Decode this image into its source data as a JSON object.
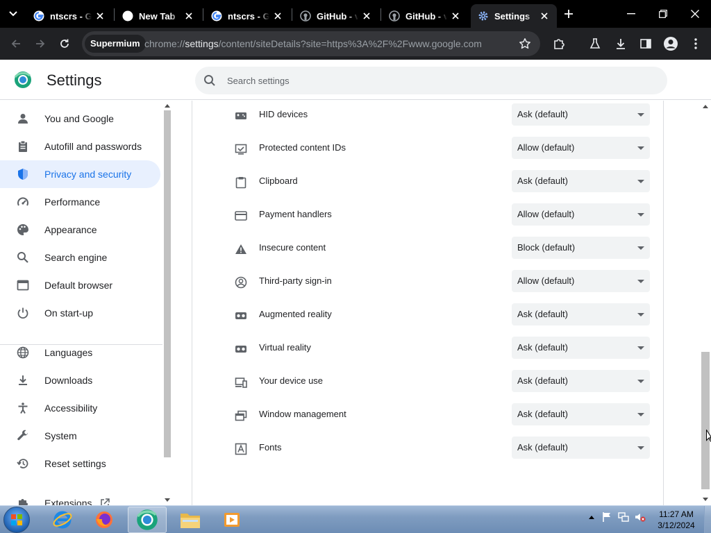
{
  "tabs": [
    {
      "title": "ntscrs - Go",
      "favicon": "google-icon"
    },
    {
      "title": "New Tab",
      "favicon": "newtab-icon"
    },
    {
      "title": "ntscrs - Go",
      "favicon": "google-icon"
    },
    {
      "title": "GitHub - v",
      "favicon": "github-icon"
    },
    {
      "title": "GitHub - v",
      "favicon": "github-icon"
    },
    {
      "title": "Settings",
      "favicon": "gear-icon",
      "active": true
    }
  ],
  "toolbar": {
    "browser_chip": "Supermium",
    "url_prefix": "chrome://",
    "url_host": "settings",
    "url_rest": "/content/siteDetails?site=https%3A%2F%2Fwww.google.com"
  },
  "header": {
    "title": "Settings",
    "search_placeholder": "Search settings"
  },
  "sidebar": {
    "items": [
      {
        "label": "You and Google",
        "icon": "person-icon"
      },
      {
        "label": "Autofill and passwords",
        "icon": "clipboard-icon"
      },
      {
        "label": "Privacy and security",
        "icon": "shield-icon",
        "selected": true
      },
      {
        "label": "Performance",
        "icon": "speedometer-icon"
      },
      {
        "label": "Appearance",
        "icon": "palette-icon"
      },
      {
        "label": "Search engine",
        "icon": "search-icon"
      },
      {
        "label": "Default browser",
        "icon": "browser-icon"
      },
      {
        "label": "On start-up",
        "icon": "power-icon"
      },
      {
        "label": "Languages",
        "icon": "globe-icon"
      },
      {
        "label": "Downloads",
        "icon": "download-icon"
      },
      {
        "label": "Accessibility",
        "icon": "accessibility-icon"
      },
      {
        "label": "System",
        "icon": "wrench-icon"
      },
      {
        "label": "Reset settings",
        "icon": "restore-icon"
      },
      {
        "label": "Extensions",
        "icon": "puzzle-icon"
      }
    ]
  },
  "permissions": [
    {
      "label": "HID devices",
      "value": "Ask (default)",
      "icon": "hid-icon"
    },
    {
      "label": "Protected content IDs",
      "value": "Allow (default)",
      "icon": "protected-content-icon"
    },
    {
      "label": "Clipboard",
      "value": "Ask (default)",
      "icon": "clipboard-icon"
    },
    {
      "label": "Payment handlers",
      "value": "Allow (default)",
      "icon": "credit-card-icon"
    },
    {
      "label": "Insecure content",
      "value": "Block (default)",
      "icon": "warning-icon"
    },
    {
      "label": "Third-party sign-in",
      "value": "Allow (default)",
      "icon": "account-circle-icon"
    },
    {
      "label": "Augmented reality",
      "value": "Ask (default)",
      "icon": "vr-headset-icon"
    },
    {
      "label": "Virtual reality",
      "value": "Ask (default)",
      "icon": "vr-headset-icon"
    },
    {
      "label": "Your device use",
      "value": "Ask (default)",
      "icon": "devices-icon"
    },
    {
      "label": "Window management",
      "value": "Ask (default)",
      "icon": "window-icon"
    },
    {
      "label": "Fonts",
      "value": "Ask (default)",
      "icon": "font-icon"
    }
  ],
  "taskbar": {
    "time": "11:27 AM",
    "date": "3/12/2024"
  },
  "colors": {
    "accent": "#1a73e8",
    "selected_bg": "#e8f0fe",
    "tab_strip": "#000000",
    "toolbar": "#202124"
  }
}
